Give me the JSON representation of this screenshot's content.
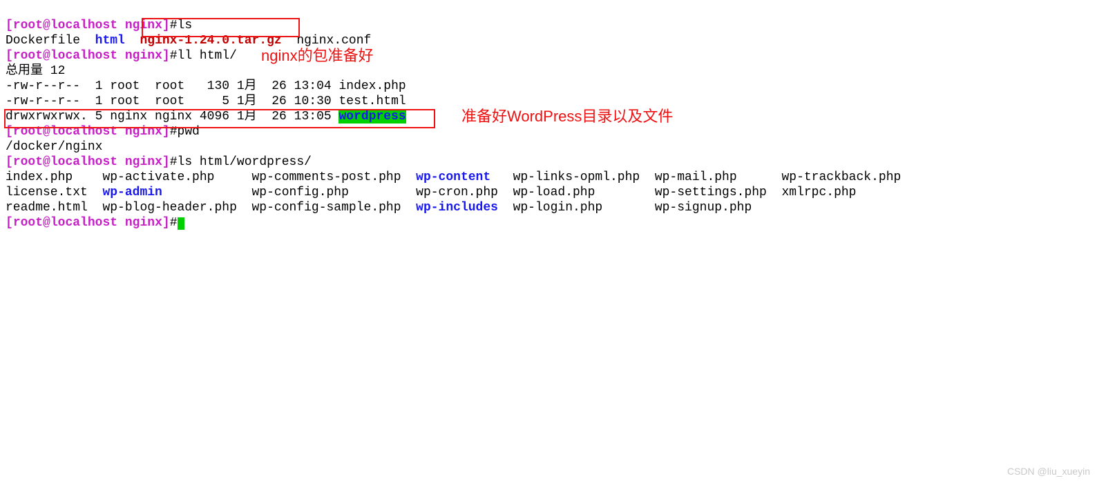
{
  "prompt": {
    "open": "[",
    "user": "root",
    "at": "@",
    "host": "localhost",
    "space": " ",
    "dir": "nginx",
    "close": "]",
    "hash": "#"
  },
  "cmd": {
    "ls": "ls",
    "ll_html": "ll html/",
    "pwd": "pwd",
    "ls_wp": "ls html/wordpress/"
  },
  "ls1": {
    "dockerfile": "Dockerfile",
    "html": "html",
    "nginx_tar": "nginx-1.24.0.tar.gz",
    "nginx_conf": "nginx.conf"
  },
  "ll": {
    "total": "总用量 12",
    "r1": "-rw-r--r--  1 root  root   130 1月  26 13:04 index.php",
    "r2": "-rw-r--r--  1 root  root     5 1月  26 10:30 test.html",
    "r3a": "drwxrwxrwx. 5 nginx nginx 4096 1月  26 13:05 ",
    "r3b": "wordpress"
  },
  "pwd_out": "/docker/nginx",
  "wp_cols": {
    "c1a": "index.php",
    "c1b": "license.txt",
    "c1c": "readme.html",
    "c2a": "wp-activate.php",
    "c2b": "wp-admin",
    "c2c": "wp-blog-header.php",
    "c3a": "wp-comments-post.php",
    "c3b": "wp-config.php",
    "c3c": "wp-config-sample.php",
    "c4a": "wp-content",
    "c4b": "wp-cron.php",
    "c4c": "wp-includes",
    "c5a": "wp-links-opml.php",
    "c5b": "wp-load.php",
    "c5c": "wp-login.php",
    "c6a": "wp-mail.php",
    "c6b": "wp-settings.php",
    "c6c": "wp-signup.php",
    "c7a": "wp-trackback.php",
    "c7b": "xmlrpc.php"
  },
  "anno": {
    "nginx_pkg": "nginx的包准备好",
    "wp_dir": "准备好WordPress目录以及文件"
  },
  "watermark": "CSDN @liu_xueyin"
}
